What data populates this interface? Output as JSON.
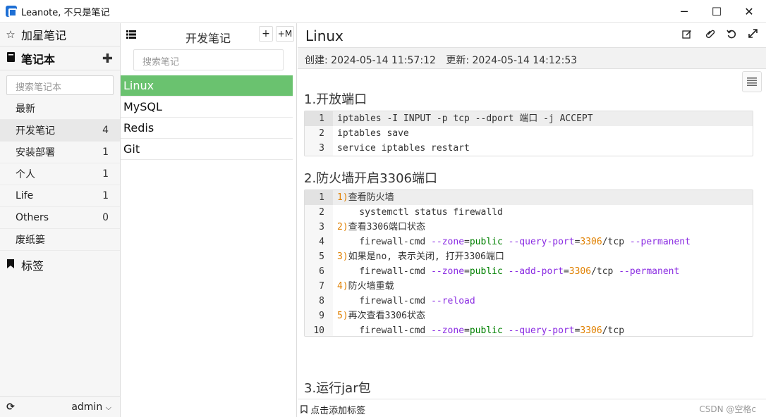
{
  "window": {
    "title": "Leanote, 不只是笔记",
    "minimize": "─",
    "maximize": "☐",
    "close": "✕"
  },
  "sidebar": {
    "starred_label": "加星笔记",
    "notebooks_label": "笔记本",
    "search_placeholder": "搜索笔记本",
    "notebooks": [
      {
        "label": "最新",
        "count": ""
      },
      {
        "label": "开发笔记",
        "count": "4"
      },
      {
        "label": "安装部署",
        "count": "1"
      },
      {
        "label": "个人",
        "count": "1"
      },
      {
        "label": "Life",
        "count": "1"
      },
      {
        "label": "Others",
        "count": "0"
      },
      {
        "label": "废纸篓",
        "count": ""
      }
    ],
    "tags_label": "标签",
    "user": "admin"
  },
  "notelist": {
    "title": "开发笔记",
    "add_label": "+",
    "add_markdown_label": "+M",
    "search_placeholder": "搜索笔记",
    "notes": [
      "Linux",
      "MySQL",
      "Redis",
      "Git"
    ]
  },
  "editor": {
    "title": "Linux",
    "created_label": "创建:",
    "created": "2024-05-14 11:57:12",
    "updated_label": "更新:",
    "updated": "2024-05-14 14:12:53",
    "sections": [
      {
        "heading": "1.开放端口"
      },
      {
        "heading": "2.防火墙开启3306端口"
      },
      {
        "heading": "3.运行jar包"
      }
    ],
    "code1": [
      "iptables -I INPUT -p tcp --dport 端口 -j ACCEPT",
      "iptables save",
      "service iptables restart"
    ],
    "code2": [
      {
        "n": "1",
        "t": "1)查看防火墙"
      },
      {
        "n": "2",
        "t": "    systemctl status firewalld"
      },
      {
        "n": "3",
        "t": "2)查看3306端口状态"
      },
      {
        "n": "4",
        "t": "    firewall-cmd --zone=public --query-port=3306/tcp --permanent"
      },
      {
        "n": "5",
        "t": "3)如果是no, 表示关闭, 打开3306端口"
      },
      {
        "n": "6",
        "t": "    firewall-cmd --zone=public --add-port=3306/tcp --permanent"
      },
      {
        "n": "7",
        "t": "4)防火墙重载"
      },
      {
        "n": "8",
        "t": "    firewall-cmd --reload"
      },
      {
        "n": "9",
        "t": "5)再次查看3306状态"
      },
      {
        "n": "10",
        "t": "    firewall-cmd --zone=public --query-port=3306/tcp"
      }
    ],
    "add_tag_label": "点击添加标签",
    "watermark": "CSDN @空格c"
  }
}
